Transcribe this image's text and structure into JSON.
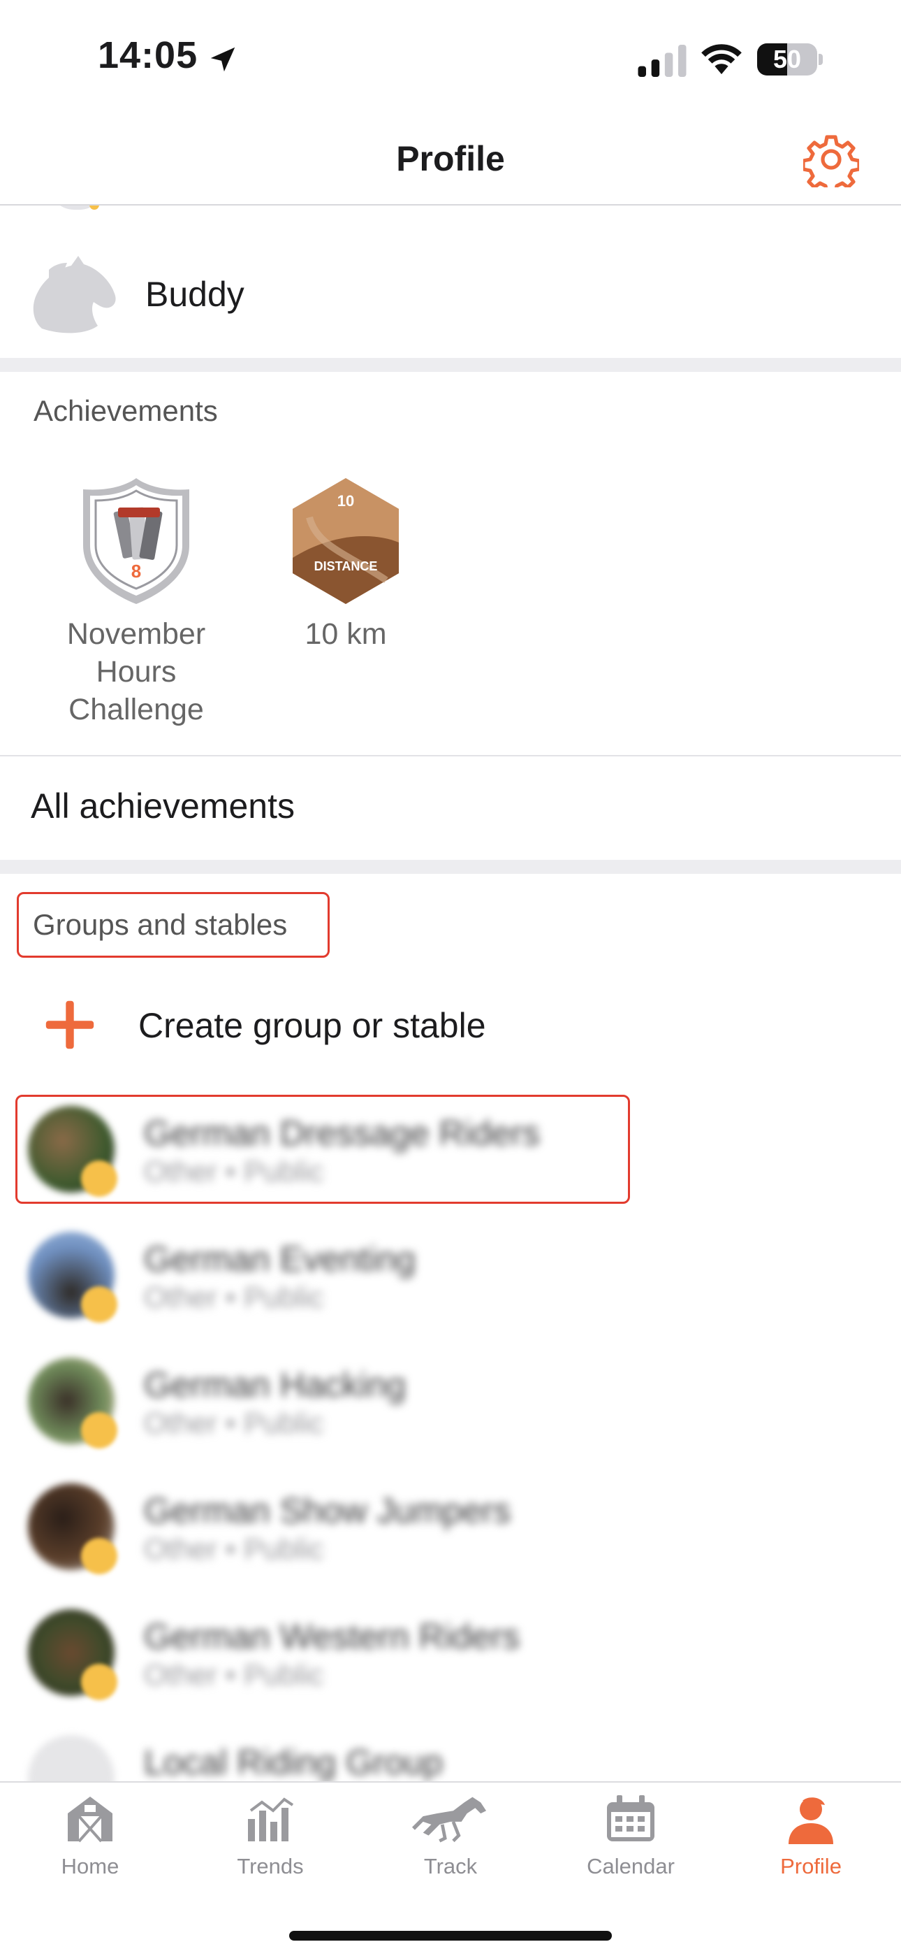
{
  "status_bar": {
    "time": "14:05",
    "battery": "50",
    "battery_level_percent": 50
  },
  "nav": {
    "title": "Profile",
    "settings_icon": "gear-icon",
    "accent": "#ee6a3c"
  },
  "horse": {
    "name": "Buddy"
  },
  "achievements": {
    "header": "Achievements",
    "items": [
      {
        "badge_number": "8",
        "label_lines": [
          "November",
          "Hours",
          "Challenge"
        ],
        "icon": "shield-badge-icon"
      },
      {
        "badge_number": "10",
        "badge_caption": "DISTANCE",
        "label_lines": [
          "10 km"
        ],
        "icon": "hexagon-badge-icon"
      }
    ],
    "all_label": "All achievements"
  },
  "groups": {
    "header": "Groups and stables",
    "create_label": "Create group or stable",
    "items": [
      {
        "name": "German Dressage Riders",
        "meta": "Other • Public"
      },
      {
        "name": "German Eventing",
        "meta": "Other • Public"
      },
      {
        "name": "German Hacking",
        "meta": "Other • Public"
      },
      {
        "name": "German Show Jumpers",
        "meta": "Other • Public"
      },
      {
        "name": "German Western Riders",
        "meta": "Other • Public"
      },
      {
        "name": "Local Riding Group",
        "meta": ""
      }
    ]
  },
  "tabs": [
    {
      "label": "Home",
      "icon": "barn-icon",
      "active": false
    },
    {
      "label": "Trends",
      "icon": "bar-chart-icon",
      "active": false
    },
    {
      "label": "Track",
      "icon": "running-horse-icon",
      "active": false
    },
    {
      "label": "Calendar",
      "icon": "calendar-icon",
      "active": false
    },
    {
      "label": "Profile",
      "icon": "person-icon",
      "active": true
    }
  ]
}
